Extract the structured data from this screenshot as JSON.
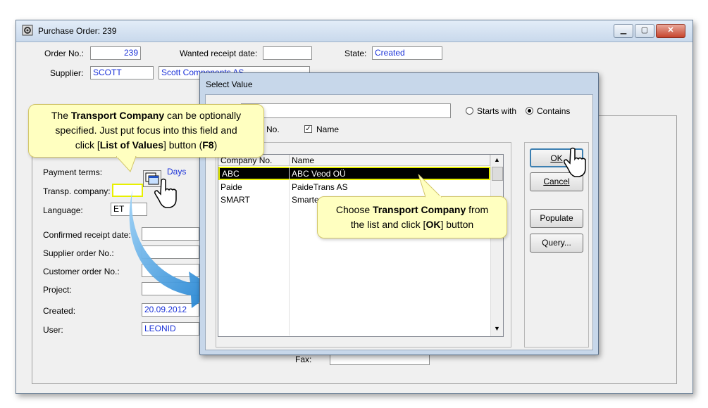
{
  "main_window": {
    "title": "Purchase Order: 239",
    "order_no_label": "Order No.:",
    "order_no_value": "239",
    "wanted_receipt_label": "Wanted receipt date:",
    "wanted_receipt_value": "",
    "state_label": "State:",
    "state_value": "Created",
    "supplier_label": "Supplier:",
    "supplier_code": "SCOTT",
    "supplier_name": "Scott Components AS",
    "payment_terms_label": "Payment terms:",
    "payment_days_label": "Days",
    "transp_company_label": "Transp. company:",
    "transp_company_value": "",
    "language_label": "Language:",
    "language_value": "ET",
    "confirmed_receipt_label": "Confirmed receipt date:",
    "supplier_order_label": "Supplier order No.:",
    "customer_order_label": "Customer order No.:",
    "project_label": "Project:",
    "created_label": "Created:",
    "created_value": "20.09.2012",
    "user_label": "User:",
    "user_value": "LEONID",
    "fax_label": "Fax:"
  },
  "dialog": {
    "title": "Select Value",
    "starts_with_label": "Starts with",
    "contains_label": "Contains",
    "no_checkbox_label": "No.",
    "name_checkbox_label": "Name",
    "ok_label": "OK",
    "cancel_label": "Cancel",
    "populate_label": "Populate",
    "query_label": "Query...",
    "columns": [
      "Company No.",
      "Name"
    ],
    "rows": [
      {
        "no": "ABC",
        "name": "ABC Veod OÜ"
      },
      {
        "no": "Paide",
        "name": "PaideTrans AS"
      },
      {
        "no": "SMART",
        "name": "Smarte"
      }
    ]
  },
  "callouts": {
    "c1_line1_a": "The ",
    "c1_line1_b": "Transport Company",
    "c1_line1_c": " can be optionally",
    "c1_line2": "specified.  Just put focus into this field and",
    "c1_line3_a": "click [",
    "c1_line3_b": "List of Values",
    "c1_line3_c": "] button (",
    "c1_line3_d": "F8",
    "c1_line3_e": ")",
    "c2_line1_a": "Choose ",
    "c2_line1_b": "Transport Company",
    "c2_line1_c": " from",
    "c2_line2_a": "the list and click [",
    "c2_line2_b": "OK",
    "c2_line2_c": "] button"
  },
  "colors": {
    "highlight": "#e8f000",
    "selected_row": "#000000",
    "callout_bg": "#ffffc0",
    "arrow": "#2e9be0"
  }
}
